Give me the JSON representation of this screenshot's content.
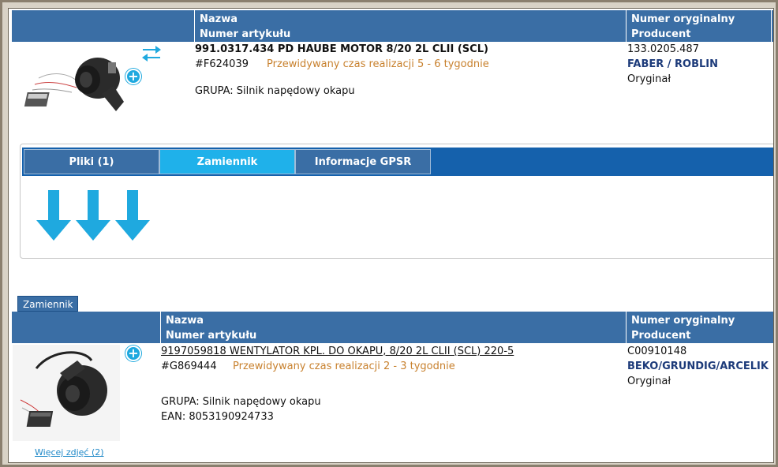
{
  "header1": {
    "col1_line1": "Nazwa",
    "col1_line2": "Numer artykułu",
    "col2_line1": "Numer oryginalny",
    "col2_line2": "Producent"
  },
  "product": {
    "name": "991.0317.434 PD HAUBE MOTOR 8/20 2L CLII (SCL)",
    "article": "#F624039",
    "lead_time": "Przewidywany czas realizacji 5 - 6 tygodnie",
    "group": "GRUPA: Silnik napędowy okapu",
    "orig_number": "133.0205.487",
    "manufacturer": "FABER / ROBLIN",
    "type": "Oryginał"
  },
  "tabs": [
    {
      "label": "Pliki (1)"
    },
    {
      "label": "Zamiennik"
    },
    {
      "label": "Informacje GPSR"
    }
  ],
  "section_badge": "Zamiennik",
  "header2": {
    "col1_line1": "Nazwa",
    "col1_line2": "Numer artykułu",
    "col2_line1": "Numer oryginalny",
    "col2_line2": "Producent"
  },
  "replacement": {
    "name": "9197059818 WENTYLATOR KPL. DO OKAPU, 8/20 2L CLII (SCL) 220-5",
    "article": "#G869444",
    "lead_time": "Przewidywany czas realizacji 2 - 3 tygodnie",
    "group": "GRUPA: Silnik napędowy okapu",
    "ean": "EAN: 8053190924733",
    "orig_number": "C00910148",
    "manufacturer": "BEKO/GRUNDIG/ARCELIK",
    "type": "Oryginał",
    "more_photos": "Więcej zdjęć (2)"
  },
  "colors": {
    "header_blue": "#3a6ea5",
    "tabbar_blue": "#1561ac",
    "active_tab": "#1fb1ea",
    "arrow_blue": "#1fa9df",
    "lead_time_orange": "#c8812e",
    "manufacturer_navy": "#1d3b7a"
  }
}
